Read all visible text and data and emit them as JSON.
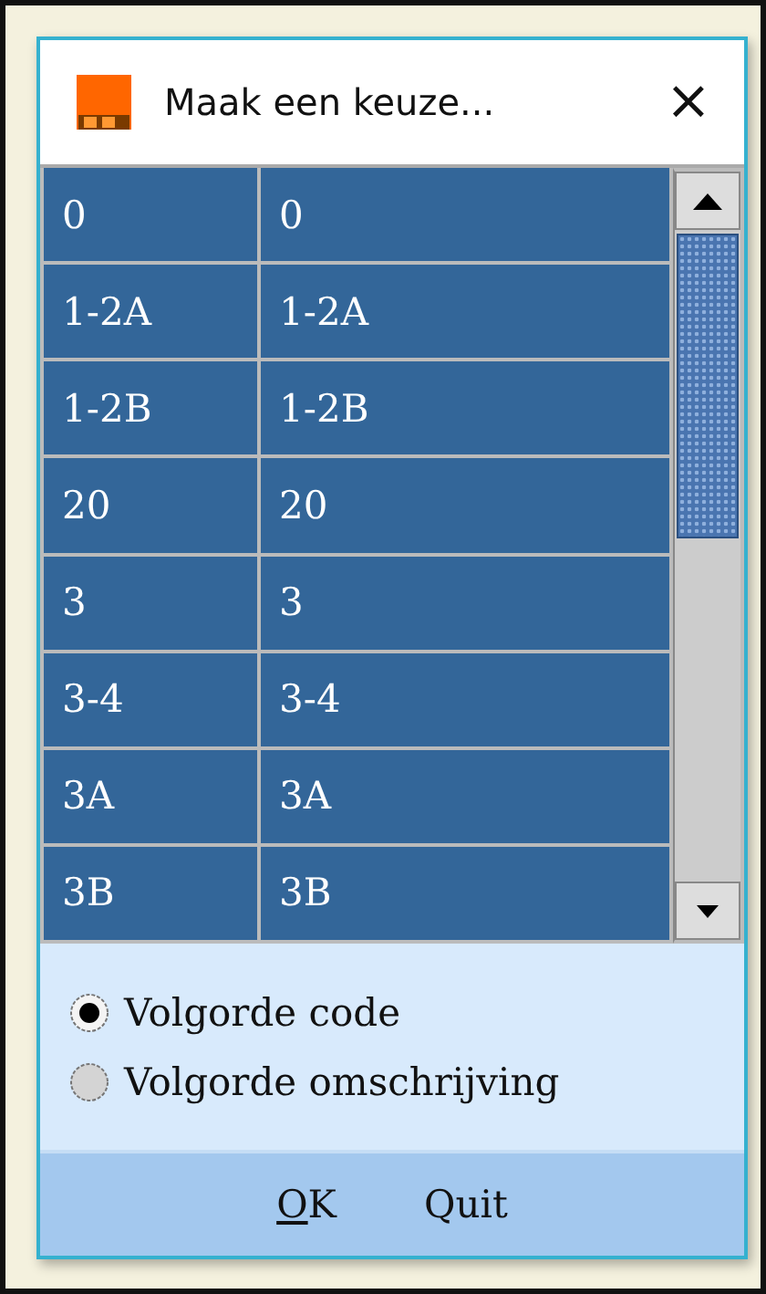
{
  "window": {
    "title": "Maak een keuze...",
    "close": "×"
  },
  "table": {
    "rows": [
      [
        "0",
        "0"
      ],
      [
        "1-2A",
        "1-2A"
      ],
      [
        "1-2B",
        "1-2B"
      ],
      [
        "20",
        "20"
      ],
      [
        "3",
        "3"
      ],
      [
        "3-4",
        "3-4"
      ],
      [
        "3A",
        "3A"
      ],
      [
        "3B",
        "3B"
      ]
    ]
  },
  "sort_options": [
    {
      "label": "Volgorde code",
      "selected": true
    },
    {
      "label": "Volgorde omschrijving",
      "selected": false
    }
  ],
  "buttons": [
    {
      "label": "OK",
      "mnemonic": true
    },
    {
      "label": "Quit",
      "mnemonic": false
    }
  ]
}
